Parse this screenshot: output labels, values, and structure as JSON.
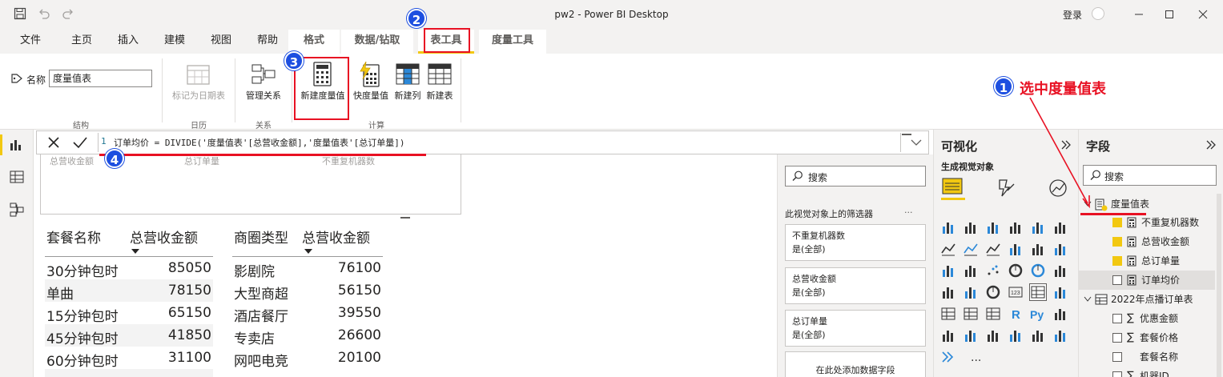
{
  "titlebar": {
    "title": "pw2 - Power BI Desktop",
    "signin": "登录"
  },
  "tabs": [
    {
      "label": "文件"
    },
    {
      "label": "主页"
    },
    {
      "label": "插入"
    },
    {
      "label": "建模"
    },
    {
      "label": "视图"
    },
    {
      "label": "帮助"
    },
    {
      "label": "格式"
    },
    {
      "label": "数据/钻取"
    },
    {
      "label": "表工具"
    },
    {
      "label": "度量工具"
    }
  ],
  "ribbon": {
    "name_label": "名称",
    "name_value": "度量值表",
    "mark_date": "标记为日期表",
    "manage_rel": "管理关系",
    "new_measure": "新建度量值",
    "quick_measure": "快度量值",
    "new_column": "新建列",
    "new_table": "新建表",
    "groups": {
      "structure": "结构",
      "calendar": "日历",
      "relations": "关系",
      "calc": "计算"
    }
  },
  "formula": {
    "line": "1",
    "text": "订单均价 = DIVIDE('度量值表'[总营收金额],'度量值表'[总订单量])"
  },
  "canvas": {
    "cards": [
      "总营收金额",
      "总订单量",
      "不重复机器数"
    ],
    "table1": {
      "headers": [
        "套餐名称",
        "总营收金额"
      ],
      "rows": [
        [
          "30分钟包时",
          "85050"
        ],
        [
          "单曲",
          "78150"
        ],
        [
          "15分钟包时",
          "65150"
        ],
        [
          "45分钟包时",
          "41850"
        ],
        [
          "60分钟包时",
          "31100"
        ]
      ]
    },
    "table2": {
      "headers": [
        "商圈类型",
        "总营收金额"
      ],
      "rows": [
        [
          "影剧院",
          "76100"
        ],
        [
          "大型商超",
          "56150"
        ],
        [
          "酒店餐厅",
          "39550"
        ],
        [
          "专卖店",
          "26600"
        ],
        [
          "网吧电竞",
          "20100"
        ]
      ]
    }
  },
  "filters": {
    "search": "搜索",
    "section": "此视觉对象上的筛选器",
    "more": "...",
    "items": [
      {
        "name": "不重复机器数",
        "value": "是(全部)"
      },
      {
        "name": "总营收金额",
        "value": "是(全部)"
      },
      {
        "name": "总订单量",
        "value": "是(全部)"
      }
    ],
    "add_field": "在此处添加数据字段"
  },
  "viz": {
    "title": "可视化",
    "subtitle": "生成视觉对象",
    "more": "..."
  },
  "fields": {
    "title": "字段",
    "search": "搜索",
    "tables": [
      {
        "name": "度量值表",
        "items": [
          {
            "name": "不重复机器数",
            "checked": true
          },
          {
            "name": "总营收金额",
            "checked": true
          },
          {
            "name": "总订单量",
            "checked": true
          },
          {
            "name": "订单均价",
            "checked": false
          }
        ]
      },
      {
        "name": "2022年点播订单表",
        "items": [
          {
            "name": "优惠金额",
            "checked": false,
            "sigma": true
          },
          {
            "name": "套餐价格",
            "checked": false,
            "sigma": true
          },
          {
            "name": "套餐名称",
            "checked": false,
            "sigma": false
          },
          {
            "name": "机器ID",
            "checked": false,
            "sigma": true
          }
        ]
      }
    ]
  },
  "annotations": {
    "step1": "1",
    "step2": "2",
    "step3": "3",
    "step4": "4",
    "step1_text": "选中度量值表",
    "color": "#e81123"
  }
}
